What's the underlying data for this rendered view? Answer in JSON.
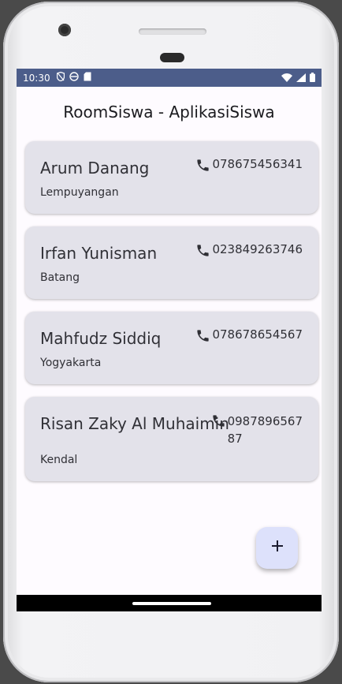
{
  "status_bar": {
    "time": "10:30",
    "left_icons": [
      "privacy-icon",
      "location-off-icon",
      "android-icon",
      "sd-card-icon"
    ],
    "right_icons": [
      "wifi-icon",
      "signal-icon",
      "battery-icon"
    ]
  },
  "app_bar": {
    "title": "RoomSiswa - AplikasiSiswa"
  },
  "students": [
    {
      "name": "Arum Danang",
      "phone": "078675456341",
      "city": "Lempuyangan"
    },
    {
      "name": "Irfan Yunisman",
      "phone": "023849263746",
      "city": "Batang"
    },
    {
      "name": "Mahfudz Siddiq",
      "phone": "078678654567",
      "city": "Yogyakarta"
    },
    {
      "name": "Risan Zaky Al Muhaimin",
      "phone_line1": "0987896567",
      "phone_line2": "87",
      "city": "Kendal"
    }
  ],
  "fab": {
    "icon": "plus-icon"
  },
  "colors": {
    "status_bar": "#4c5d8a",
    "card_bg": "#e3e2ea",
    "fab_bg": "#dde1fb",
    "screen_bg": "#fefbff"
  }
}
